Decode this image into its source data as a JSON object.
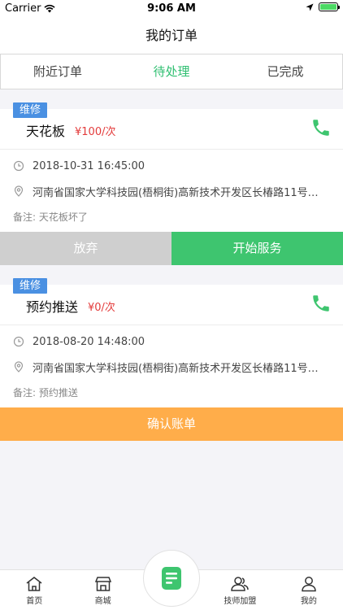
{
  "status_bar": {
    "carrier": "Carrier",
    "time": "9:06 AM"
  },
  "nav": {
    "title": "我的订单"
  },
  "tabs": [
    {
      "label": "附近订单",
      "active": false
    },
    {
      "label": "待处理",
      "active": true
    },
    {
      "label": "已完成",
      "active": false
    }
  ],
  "orders": [
    {
      "tag": "维修",
      "title": "天花板",
      "price": "¥100/次",
      "datetime": "2018-10-31 16:45:00",
      "address": "河南省国家大学科技园(梧桐街)高新技术开发区长椿路11号…",
      "note": "备注: 天花板坏了",
      "buttons": {
        "abandon": "放弃",
        "start": "开始服务"
      }
    },
    {
      "tag": "维修",
      "title": "预约推送",
      "price": "¥0/次",
      "datetime": "2018-08-20 14:48:00",
      "address": "河南省国家大学科技园(梧桐街)高新技术开发区长椿路11号…",
      "note": "备注: 预约推送",
      "buttons": {
        "confirm": "确认账单"
      }
    }
  ],
  "tabbar": {
    "home": "首页",
    "mall": "商城",
    "join": "技师加盟",
    "mine": "我的"
  },
  "colors": {
    "accent_green": "#3ec56f",
    "tag_blue": "#4a90e2",
    "price_red": "#e33b3b",
    "confirm_orange": "#ffad4a"
  }
}
